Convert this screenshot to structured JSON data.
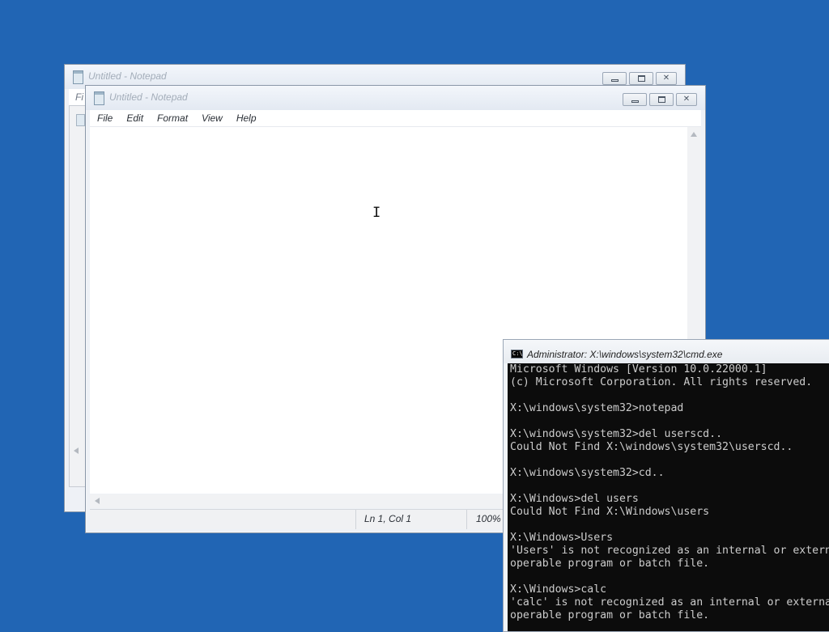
{
  "back_notepad": {
    "title": "Untitled - Notepad",
    "menu_stub": "Fi"
  },
  "notepad": {
    "title": "Untitled - Notepad",
    "menu": [
      "File",
      "Edit",
      "Format",
      "View",
      "Help"
    ],
    "status": {
      "position": "Ln 1, Col 1",
      "zoom": "100%"
    }
  },
  "cmd": {
    "icon_text": "C:\\",
    "title": "Administrator: X:\\windows\\system32\\cmd.exe",
    "lines": [
      "Microsoft Windows [Version 10.0.22000.1]",
      "(c) Microsoft Corporation. All rights reserved.",
      "",
      "X:\\windows\\system32>notepad",
      "",
      "X:\\windows\\system32>del userscd..",
      "Could Not Find X:\\windows\\system32\\userscd..",
      "",
      "X:\\windows\\system32>cd..",
      "",
      "X:\\Windows>del users",
      "Could Not Find X:\\Windows\\users",
      "",
      "X:\\Windows>Users",
      "'Users' is not recognized as an internal or external command,",
      "operable program or batch file.",
      "",
      "X:\\Windows>calc",
      "'calc' is not recognized as an internal or external command,",
      "operable program or batch file."
    ]
  },
  "colors": {
    "desktop": "#2165b4",
    "console_bg": "#0c0c0c",
    "console_text": "#cccccc"
  }
}
